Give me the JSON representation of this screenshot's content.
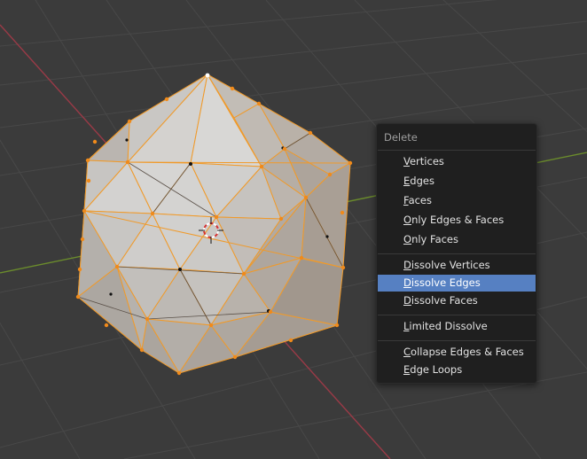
{
  "colors": {
    "background": "#3b3b3b",
    "grid": "#474747",
    "x_axis": "#9a3a47",
    "y_axis": "#6b8c2c",
    "mesh_face": "#c9c9c9",
    "selected_edge": "#f09a2a",
    "vertex": "#f08a1a",
    "menu_bg": "#1f1f1f",
    "menu_highlight": "#5680c2"
  },
  "menu": {
    "title": "Delete",
    "items": [
      {
        "mnemonic": "V",
        "rest": "ertices"
      },
      {
        "mnemonic": "E",
        "rest": "dges"
      },
      {
        "mnemonic": "F",
        "rest": "aces"
      },
      {
        "mnemonic": "O",
        "rest": "nly Edges & Faces"
      },
      {
        "mnemonic": "O",
        "rest": "nly Faces"
      },
      {
        "mnemonic": "D",
        "rest": "issolve Vertices"
      },
      {
        "mnemonic": "D",
        "rest": "issolve Edges"
      },
      {
        "mnemonic": "D",
        "rest": "issolve Faces"
      },
      {
        "mnemonic": "L",
        "rest": "imited Dissolve"
      },
      {
        "mnemonic": "C",
        "rest": "ollapse Edges & Faces"
      },
      {
        "mnemonic": "E",
        "rest": "dge Loops"
      }
    ],
    "active_item": "Dissolve Edges"
  },
  "icons": {
    "cursor": "3d-cursor-icon"
  }
}
